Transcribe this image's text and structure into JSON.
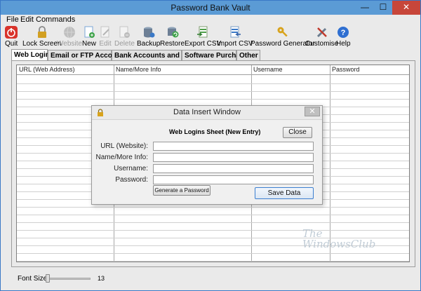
{
  "app": {
    "title": "Password Bank Vault",
    "window_controls": {
      "minimize": "—",
      "maximize": "☐",
      "close": "✕"
    }
  },
  "menu": [
    "File",
    "Edit",
    "Commands"
  ],
  "toolbar": [
    {
      "label": "Quit",
      "icon": "power-icon",
      "color": "#d9332b",
      "enabled": true
    },
    {
      "label": "Lock Screen",
      "icon": "lock-icon",
      "color": "#d2a022",
      "enabled": true
    },
    {
      "label": "Website",
      "icon": "globe-icon",
      "color": "#7d7d7d",
      "enabled": false
    },
    {
      "label": "New",
      "icon": "new-document-icon",
      "color": "#4a8fd6",
      "enabled": true
    },
    {
      "label": "Edit",
      "icon": "edit-document-icon",
      "color": "#7d7d7d",
      "enabled": false
    },
    {
      "label": "Delete",
      "icon": "delete-document-icon",
      "color": "#7d7d7d",
      "enabled": false
    },
    {
      "label": "Backup",
      "icon": "database-backup-icon",
      "color": "#6d7f95",
      "enabled": true
    },
    {
      "label": "Restore",
      "icon": "restore-icon",
      "color": "#3fa34a",
      "enabled": true
    },
    {
      "label": "Export CSV",
      "icon": "export-csv-icon",
      "color": "#4f9f4a",
      "enabled": true
    },
    {
      "label": "Import CSV",
      "icon": "import-csv-icon",
      "color": "#3b79c7",
      "enabled": true
    },
    {
      "label": "Password Generator",
      "icon": "key-icon",
      "color": "#d8a31c",
      "enabled": true
    },
    {
      "label": "Customise",
      "icon": "tools-icon",
      "color": "#6b7d8f",
      "enabled": true
    },
    {
      "label": "Help",
      "icon": "help-icon",
      "color": "#2f6fd1",
      "enabled": true
    }
  ],
  "tabs": [
    {
      "label": "Web Logins",
      "active": true
    },
    {
      "label": "Email or FTP Accounts",
      "active": false
    },
    {
      "label": "Bank Accounts and PIN's",
      "active": false
    },
    {
      "label": "Software Purchases",
      "active": false
    },
    {
      "label": "Other",
      "active": false
    }
  ],
  "table": {
    "columns": [
      "URL (Web Address)",
      "Name/More Info",
      "Username",
      "Password"
    ],
    "rows": []
  },
  "dialog": {
    "title": "Data Insert Window",
    "close_x": "✕",
    "heading": "Web Logins Sheet (New Entry)",
    "close_button": "Close",
    "fields": [
      {
        "label": "URL (Website):",
        "value": ""
      },
      {
        "label": "Name/More Info:",
        "value": ""
      },
      {
        "label": "Username:",
        "value": ""
      },
      {
        "label": "Password:",
        "value": ""
      }
    ],
    "generate_button": "Generate a Password",
    "save_button": "Save Data"
  },
  "watermark": {
    "line1": "The",
    "line2": "WindowsClub"
  },
  "status": {
    "font_size_label": "Font Size",
    "font_size_value": "13"
  }
}
